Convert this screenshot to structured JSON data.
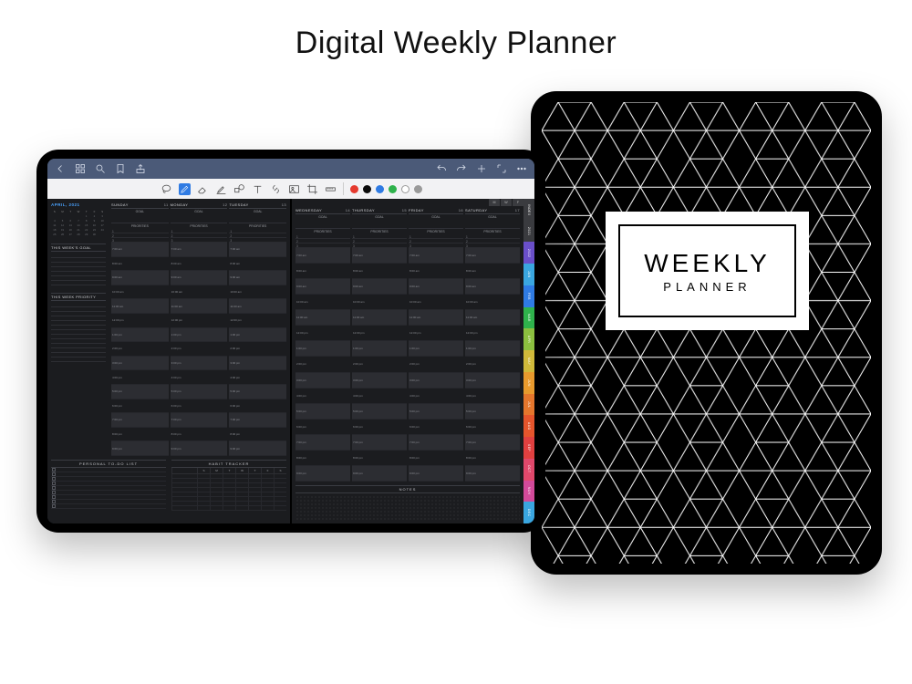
{
  "title": "Digital Weekly Planner",
  "cover": {
    "line1": "WEEKLY",
    "line2": "PLANNER"
  },
  "appbar": {
    "icons_left": [
      "back",
      "grid",
      "search",
      "bookmark",
      "share"
    ],
    "icons_right": [
      "undo",
      "redo",
      "add",
      "expand",
      "more"
    ]
  },
  "toolbar": {
    "icons": [
      "lasso",
      "pen",
      "eraser",
      "highlighter",
      "shapes",
      "text",
      "link",
      "image",
      "crop",
      "ruler"
    ],
    "swatches": [
      "#e53a2f",
      "#0b0b0b",
      "#2f7be3",
      "#2fb24c",
      "#ffffff",
      "#9a9a9a"
    ]
  },
  "planner": {
    "month_label": "APRIL, 2021",
    "calendar_dow": [
      "S",
      "M",
      "T",
      "W",
      "T",
      "F",
      "S"
    ],
    "calendar_days": [
      "",
      "",
      "",
      "",
      "1",
      "2",
      "3",
      "4",
      "5",
      "6",
      "7",
      "8",
      "9",
      "10",
      "11",
      "12",
      "13",
      "14",
      "15",
      "16",
      "17",
      "18",
      "19",
      "20",
      "21",
      "22",
      "23",
      "24",
      "25",
      "26",
      "27",
      "28",
      "29",
      "30",
      ""
    ],
    "sections": {
      "weeks_goal": "THIS WEEK'S GOAL",
      "week_priority": "THIS WEEK PRIORITY",
      "todo": "PERSONAL TO-DO LIST",
      "habit": "HABIT TRACKER",
      "notes": "NOTES",
      "goal": "GOAL",
      "priorities": "PRIORITIES"
    },
    "habit_dow": [
      "S",
      "M",
      "T",
      "W",
      "T",
      "F",
      "S"
    ],
    "left_days": [
      {
        "name": "SUNDAY",
        "num": "11"
      },
      {
        "name": "MONDAY",
        "num": "12"
      },
      {
        "name": "TUESDAY",
        "num": "13"
      }
    ],
    "right_days": [
      {
        "name": "WEDNESDAY",
        "num": "14"
      },
      {
        "name": "THURSDAY",
        "num": "15"
      },
      {
        "name": "FRIDAY",
        "num": "16"
      },
      {
        "name": "SATURDAY",
        "num": "17"
      }
    ],
    "time_slots": [
      "7:00 am",
      "8:00 am",
      "9:00 am",
      "10:00 am",
      "11:00 am",
      "12:00 pm",
      "1:00 pm",
      "2:00 pm",
      "3:00 pm",
      "4:00 pm",
      "5:00 pm",
      "6:00 pm",
      "7:00 pm",
      "8:00 pm",
      "9:00 pm"
    ],
    "top_tabs": [
      "M",
      "W",
      "F"
    ],
    "side_tabs": [
      {
        "label": "INDEX",
        "color": "#3a3b3f"
      },
      {
        "label": "2021",
        "color": "#3a3b3f"
      },
      {
        "label": "2022",
        "color": "#6a4fc9"
      },
      {
        "label": "JAN",
        "color": "#3aa6e0"
      },
      {
        "label": "FEB",
        "color": "#2f7be3"
      },
      {
        "label": "MAR",
        "color": "#2fb24c"
      },
      {
        "label": "APR",
        "color": "#8bbf3f"
      },
      {
        "label": "MAY",
        "color": "#d0b93a"
      },
      {
        "label": "JUN",
        "color": "#e89a2d"
      },
      {
        "label": "JUL",
        "color": "#e5762c"
      },
      {
        "label": "AUG",
        "color": "#e5552c"
      },
      {
        "label": "SEP",
        "color": "#e04040"
      },
      {
        "label": "OCT",
        "color": "#e0486b"
      },
      {
        "label": "NOV",
        "color": "#d24a9a"
      },
      {
        "label": "DEC",
        "color": "#3aa6e0"
      }
    ]
  }
}
